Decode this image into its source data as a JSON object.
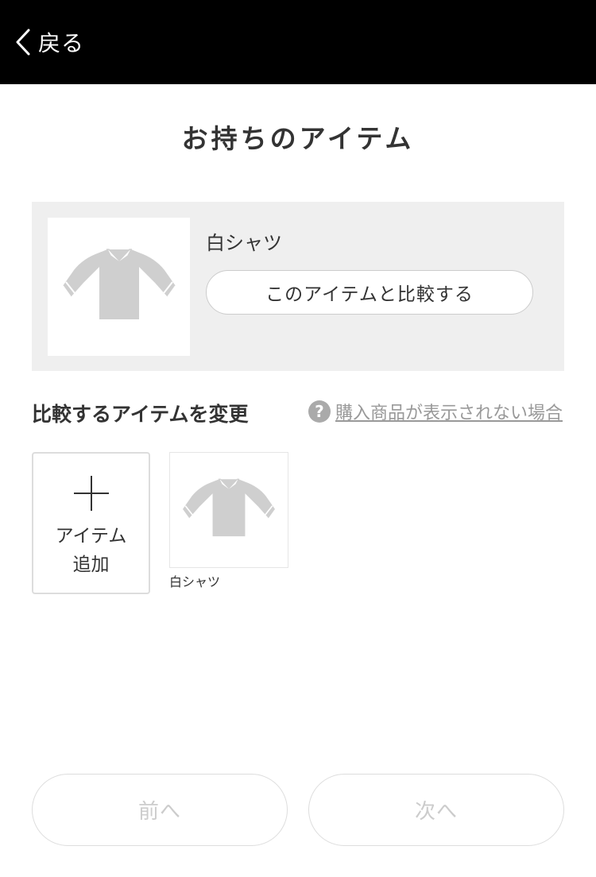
{
  "header": {
    "back_label": "戻る",
    "background": "#000000"
  },
  "title": "お持ちのアイテム",
  "owned_item": {
    "name": "白シャツ",
    "compare_button": "このアイテムと比較する",
    "icon": "shirt-icon"
  },
  "change_section": {
    "title": "比較するアイテムを変更",
    "help_icon": "?",
    "help_link": "購入商品が表示されない場合"
  },
  "add_tile": {
    "line1": "アイテム",
    "line2": "追加"
  },
  "candidates": [
    {
      "name": "白シャツ",
      "icon": "shirt-icon"
    }
  ],
  "nav": {
    "prev_label": "前へ",
    "next_label": "次へ",
    "disabled_color": "#cccccc"
  }
}
